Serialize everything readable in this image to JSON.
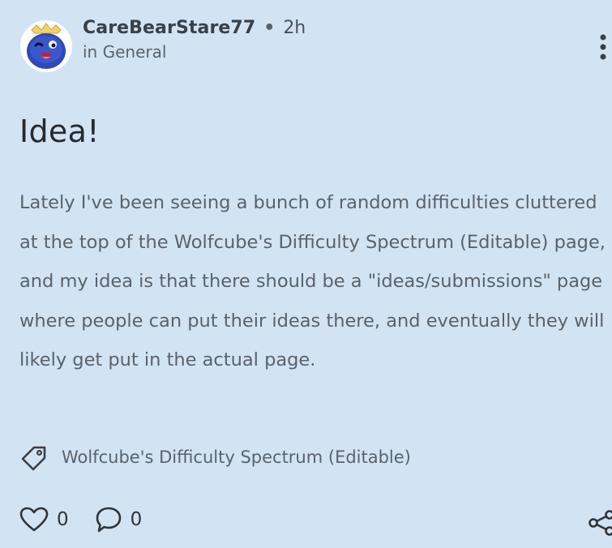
{
  "post": {
    "author": "CareBearStare77",
    "separator": "•",
    "time": "2h",
    "category": "in General",
    "title": "Idea!",
    "body": "Lately I've been seeing a bunch of random difficulties cluttered at the top of the Wolfcube's Difficulty Spectrum (Editable) page, and my idea is that there should be a \"ideas/submissions\" page where people can put their ideas there, and eventually they will likely get put in the actual page.",
    "tag": "Wolfcube's Difficulty Spectrum (Editable)",
    "likes": "0",
    "comments": "0"
  },
  "icons": {
    "avatar": "avatar-blue-creature",
    "more": "more-vertical-icon",
    "tag": "tag-icon",
    "like": "heart-outline-icon",
    "comment": "speech-bubble-icon",
    "share": "share-icon"
  },
  "colors": {
    "background": "#d2e3f4",
    "text": "#262a2e",
    "muted": "#5b6269"
  }
}
